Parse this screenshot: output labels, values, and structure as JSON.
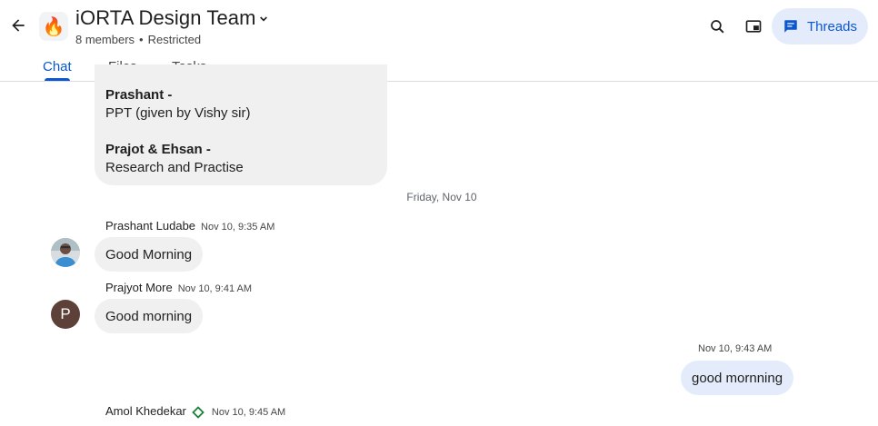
{
  "header": {
    "space_emoji": "🔥",
    "title": "iORTA Design Team",
    "members": "8 members",
    "separator": "•",
    "access": "Restricted",
    "threads_label": "Threads"
  },
  "tabs": [
    {
      "label": "Chat",
      "active": true
    },
    {
      "label": "Files",
      "active": false
    },
    {
      "label": "Tasks",
      "active": false
    }
  ],
  "messages": {
    "previous_bubble": {
      "line1_name": "Prashant -",
      "line1_text": "PPT (given by Vishy sir)",
      "line2_name": "Prajot & Ehsan -",
      "line2_text": "Research and Practise"
    },
    "date_divider": "Friday, Nov 10",
    "items": [
      {
        "sender": "Prashant Ludabe",
        "time": "Nov 10, 9:35 AM",
        "text": "Good Morning",
        "avatar": "photo"
      },
      {
        "sender": "Prajyot More",
        "time": "Nov 10, 9:41 AM",
        "text": "Good morning",
        "avatar": "P"
      },
      {
        "sender": "",
        "time": "Nov 10, 9:43 AM",
        "text": "good mornning",
        "own": true
      },
      {
        "sender": "Amol Khedekar",
        "time": "Nov 10, 9:45 AM",
        "text": "",
        "badge": "diamond"
      }
    ]
  },
  "colors": {
    "accent": "#0b57d0",
    "threads_bg": "#e4ecfb",
    "bubble_bg": "#f0f0f0",
    "own_bubble_bg": "#e4ecfb",
    "badge_green": "#188038"
  }
}
